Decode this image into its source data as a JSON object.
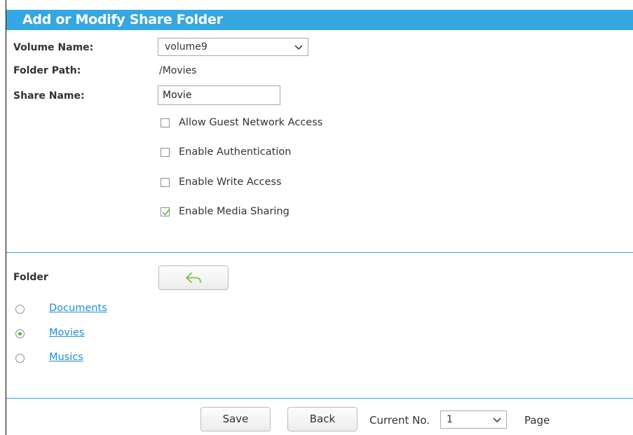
{
  "header": {
    "title": "Add or Modify Share Folder"
  },
  "form": {
    "volume_label": "Volume Name:",
    "volume_value": "volume9",
    "path_label": "Folder Path:",
    "path_value": "/Movies",
    "share_label": "Share Name:",
    "share_value": "Movie",
    "options": [
      {
        "label": "Allow Guest Network Access",
        "checked": false
      },
      {
        "label": "Enable Authentication",
        "checked": false
      },
      {
        "label": "Enable Write Access",
        "checked": false
      },
      {
        "label": "Enable Media Sharing",
        "checked": true
      }
    ]
  },
  "folder": {
    "label": "Folder",
    "items": [
      {
        "name": "Documents",
        "selected": false
      },
      {
        "name": "Movies",
        "selected": true
      },
      {
        "name": "Musics",
        "selected": false
      }
    ]
  },
  "footer": {
    "save_label": "Save",
    "back_label": "Back",
    "current_label": "Current No.",
    "current_value": "1",
    "page_label": "Page"
  },
  "colors": {
    "accent": "#36a7e0",
    "link": "#1e8fd6",
    "check": "#5fb33c"
  }
}
